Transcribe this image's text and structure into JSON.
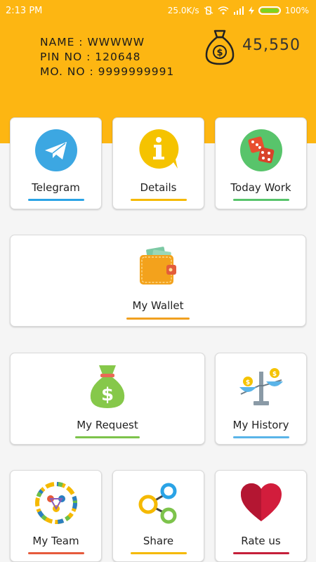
{
  "status_bar": {
    "time": "2:13 PM",
    "network_speed": "25.0K/s",
    "battery": "100%"
  },
  "user": {
    "name_line": "NAME : WWWWW",
    "pin_line": "PIN NO : 120648",
    "mobile_line": "MO. NO : 9999999991"
  },
  "balance": {
    "value": "45,550",
    "icon": "money-bag-icon"
  },
  "menu": {
    "telegram": {
      "label": "Telegram",
      "icon": "telegram-icon",
      "accent": "#2aa3e6"
    },
    "details": {
      "label": "Details",
      "icon": "info-icon",
      "accent": "#f5b900"
    },
    "today_work": {
      "label": "Today Work",
      "icon": "dice-icon",
      "accent": "#58c46b"
    },
    "my_wallet": {
      "label": "My Wallet",
      "icon": "wallet-icon",
      "accent": "#f0a020"
    },
    "my_request": {
      "label": "My Request",
      "icon": "money-bag-icon",
      "accent": "#7dc34b"
    },
    "my_history": {
      "label": "My History",
      "icon": "balance-scale-icon",
      "accent": "#5ab4e8"
    },
    "my_team": {
      "label": "My Team",
      "icon": "team-icon",
      "accent": "#e65a3c"
    },
    "share": {
      "label": "Share",
      "icon": "share-icon",
      "accent": "#f5b900"
    },
    "rate_us": {
      "label": "Rate us",
      "icon": "heart-icon",
      "accent": "#c51f3a"
    }
  }
}
